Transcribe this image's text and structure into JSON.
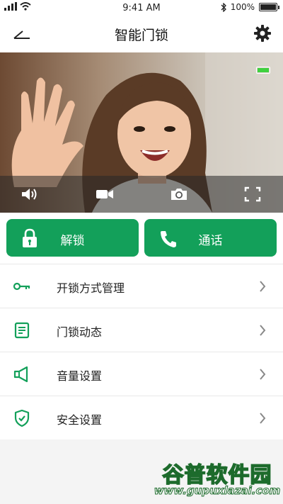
{
  "status_bar": {
    "time": "9:41 AM",
    "battery_text": "100%",
    "signal_icon": "signal-bars-icon",
    "wifi_icon": "wifi-icon",
    "bluetooth_icon": "bluetooth-icon"
  },
  "header": {
    "title": "智能门锁",
    "back_icon": "back-icon",
    "settings_icon": "gear-icon"
  },
  "video": {
    "camera_battery_level": 1.0,
    "camera_battery_color": "#3fd13f",
    "controls": [
      {
        "name": "volume",
        "icon": "speaker-icon"
      },
      {
        "name": "record",
        "icon": "video-camera-icon"
      },
      {
        "name": "snapshot",
        "icon": "camera-icon"
      },
      {
        "name": "fullscreen",
        "icon": "fullscreen-icon"
      }
    ]
  },
  "actions": {
    "unlock_label": "解锁",
    "unlock_icon": "lock-icon",
    "call_label": "通话",
    "call_icon": "phone-icon",
    "color": "#13a05a"
  },
  "menu": {
    "items": [
      {
        "label": "开锁方式管理",
        "icon": "key-icon"
      },
      {
        "label": "门锁动态",
        "icon": "document-icon"
      },
      {
        "label": "音量设置",
        "icon": "speaker-outline-icon"
      },
      {
        "label": "安全设置",
        "icon": "shield-check-icon"
      }
    ],
    "icon_color": "#13a05a"
  },
  "watermark": {
    "name": "谷普软件园",
    "url": "www.gupuxlazai.com"
  }
}
